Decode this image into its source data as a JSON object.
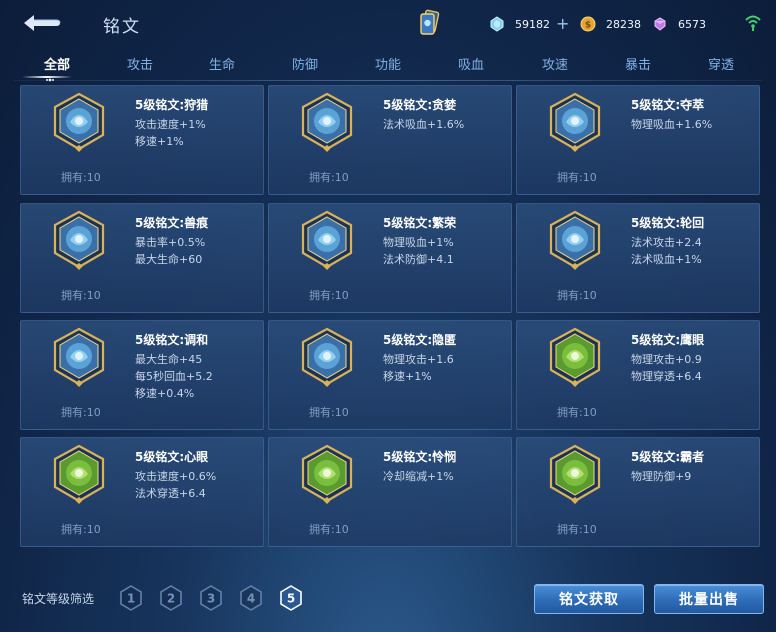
{
  "header": {
    "title": "铭文",
    "currencies": {
      "diamond": "59182",
      "gold": "28238",
      "voucher": "6573"
    },
    "icons": [
      "back-arrow-icon",
      "card-deck-icon",
      "diamond-icon",
      "gold-coin-icon",
      "voucher-gem-icon",
      "signal-icon"
    ]
  },
  "tabs": [
    "全部",
    "攻击",
    "生命",
    "防御",
    "功能",
    "吸血",
    "攻速",
    "暴击",
    "穿透"
  ],
  "active_tab": "全部",
  "runes": [
    {
      "name": "5级铭文:狩猎",
      "attrs": [
        "攻击速度+1%",
        "移速+1%"
      ],
      "owned": "拥有:10",
      "color": "#3a6fa8",
      "icon": "hunt-rune-icon"
    },
    {
      "name": "5级铭文:贪婪",
      "attrs": [
        "法术吸血+1.6%"
      ],
      "owned": "拥有:10",
      "color": "#3a6fa8",
      "icon": "greed-rune-icon"
    },
    {
      "name": "5级铭文:夺萃",
      "attrs": [
        "物理吸血+1.6%"
      ],
      "owned": "拥有:10",
      "color": "#3a6fa8",
      "icon": "plunder-rune-icon"
    },
    {
      "name": "5级铭文:兽痕",
      "attrs": [
        "暴击率+0.5%",
        "最大生命+60"
      ],
      "owned": "拥有:10",
      "color": "#3a6fa8",
      "icon": "beast-mark-rune-icon"
    },
    {
      "name": "5级铭文:繁荣",
      "attrs": [
        "物理吸血+1%",
        "法术防御+4.1"
      ],
      "owned": "拥有:10",
      "color": "#3a6fa8",
      "icon": "prosperity-rune-icon"
    },
    {
      "name": "5级铭文:轮回",
      "attrs": [
        "法术攻击+2.4",
        "法术吸血+1%"
      ],
      "owned": "拥有:10",
      "color": "#3a6fa8",
      "icon": "reincarnation-rune-icon"
    },
    {
      "name": "5级铭文:调和",
      "attrs": [
        "最大生命+45",
        "每5秒回血+5.2",
        "移速+0.4%"
      ],
      "owned": "拥有:10",
      "color": "#3a6fa8",
      "icon": "harmony-rune-icon"
    },
    {
      "name": "5级铭文:隐匿",
      "attrs": [
        "物理攻击+1.6",
        "移速+1%"
      ],
      "owned": "拥有:10",
      "color": "#3a6fa8",
      "icon": "stealth-rune-icon"
    },
    {
      "name": "5级铭文:鹰眼",
      "attrs": [
        "物理攻击+0.9",
        "物理穿透+6.4"
      ],
      "owned": "拥有:10",
      "color": "#5b9a2e",
      "icon": "hawkeye-rune-icon"
    },
    {
      "name": "5级铭文:心眼",
      "attrs": [
        "攻击速度+0.6%",
        "法术穿透+6.4"
      ],
      "owned": "拥有:10",
      "color": "#5b9a2e",
      "icon": "mind-eye-rune-icon"
    },
    {
      "name": "5级铭文:怜悯",
      "attrs": [
        "冷却缩减+1%"
      ],
      "owned": "拥有:10",
      "color": "#5b9a2e",
      "icon": "mercy-rune-icon"
    },
    {
      "name": "5级铭文:霸者",
      "attrs": [
        "物理防御+9"
      ],
      "owned": "拥有:10",
      "color": "#5b9a2e",
      "icon": "overlord-rune-icon"
    }
  ],
  "footer": {
    "filter_label": "铭文等级筛选",
    "levels": [
      "1",
      "2",
      "3",
      "4",
      "5"
    ],
    "active_level": "5",
    "obtain_button": "铭文获取",
    "sell_button": "批量出售"
  }
}
